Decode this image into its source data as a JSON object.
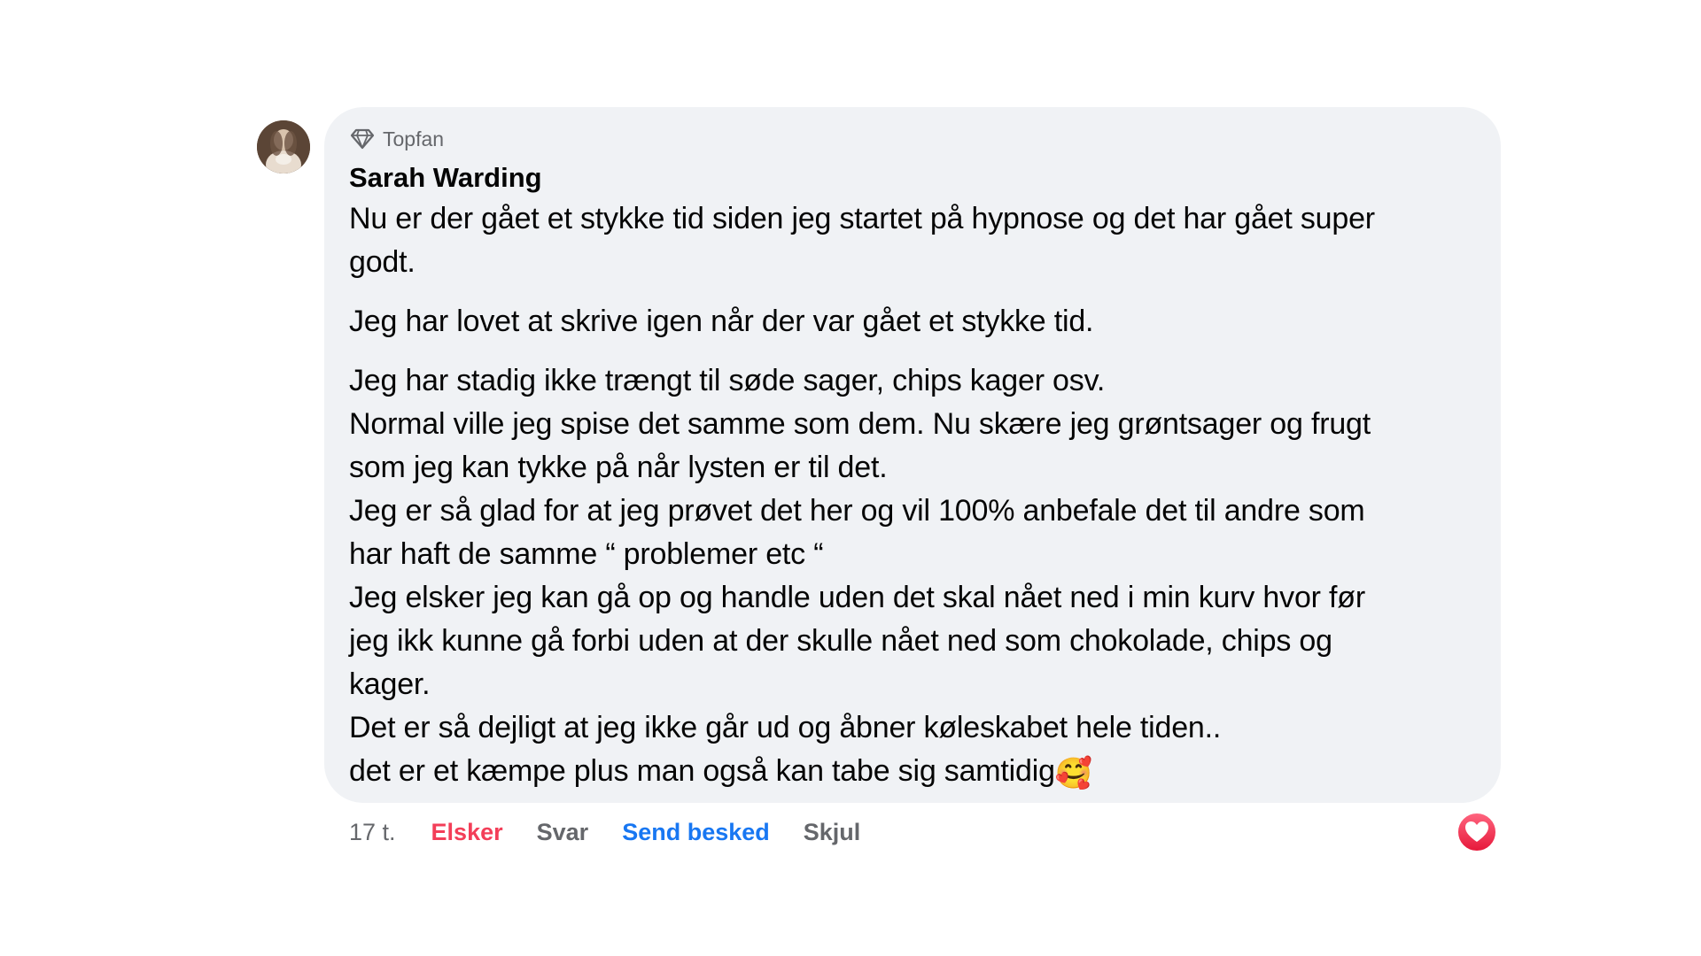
{
  "comment": {
    "badge": {
      "icon": "diamond-icon",
      "label": "Topfan"
    },
    "author": "Sarah Warding",
    "avatar_icon": "user-avatar-photo",
    "paragraphs": [
      [
        "Nu er der gået et stykke tid siden jeg startet på hypnose og det har gået super",
        "godt."
      ],
      [
        "Jeg har lovet at skrive igen når der var gået et stykke tid."
      ],
      [
        "Jeg har stadig ikke trængt til søde sager, chips kager osv.",
        "Normal ville jeg spise det samme som dem. Nu skære jeg grøntsager og frugt",
        "som jeg kan tykke på når lysten er til det.",
        "Jeg er så glad for at jeg prøvet det her og vil 100% anbefale det til andre som",
        "har haft de samme “ problemer etc “",
        "Jeg elsker jeg kan gå op og handle uden det skal nået ned i min kurv hvor før",
        "jeg ikk kunne gå forbi uden at der skulle nået ned som chokolade, chips og",
        "kager.",
        "Det er så dejligt at jeg ikke går ud og åbner køleskabet hele tiden..",
        "det er et kæmpe plus man også kan tabe sig samtidig"
      ]
    ],
    "trailing_emoji": "🥰",
    "actions": {
      "time": "17 t.",
      "love": "Elsker",
      "reply": "Svar",
      "message": "Send besked",
      "hide": "Skjul"
    },
    "reaction_icon": "heart-reaction-icon"
  },
  "colors": {
    "bubble": "#f0f2f5",
    "love": "#f33e58",
    "message": "#1877f2",
    "secondary": "#65676b",
    "text": "#050505"
  }
}
